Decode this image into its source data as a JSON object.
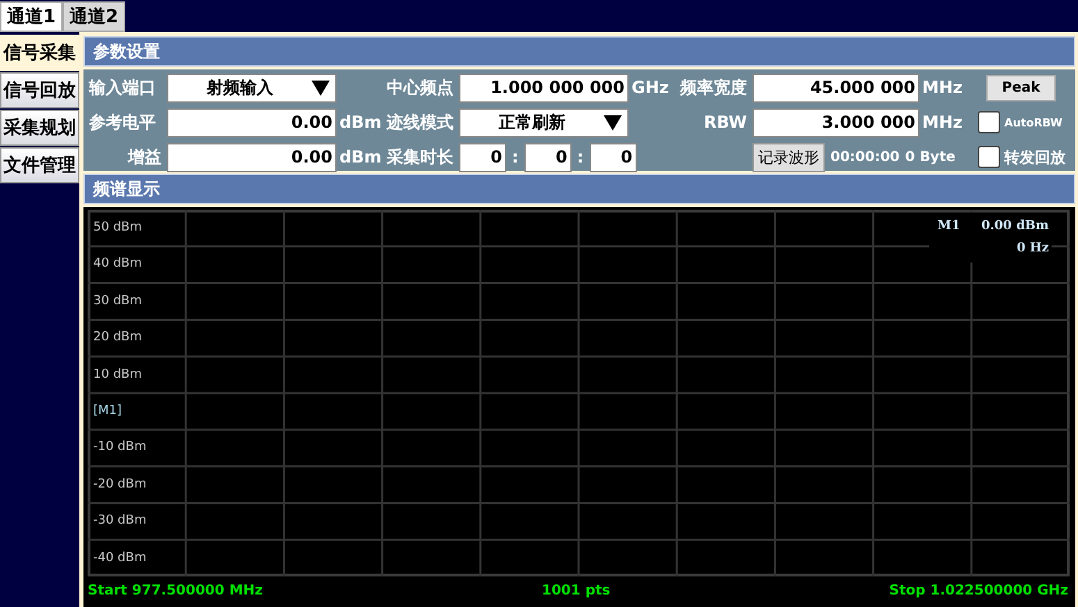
{
  "channel_tabs": [
    {
      "label": "通道1",
      "selected": true
    },
    {
      "label": "通道2",
      "selected": false
    }
  ],
  "side_tabs": [
    {
      "label": "信号采集",
      "selected": true
    },
    {
      "label": "信号回放",
      "selected": false
    },
    {
      "label": "采集规划",
      "selected": false
    },
    {
      "label": "文件管理",
      "selected": false
    }
  ],
  "params": {
    "title": "参数设置",
    "input_port": {
      "label": "输入端口",
      "value": "射频输入"
    },
    "ref_level": {
      "label": "参考电平",
      "value": "0.00",
      "unit": "dBm"
    },
    "gain": {
      "label": "增益",
      "value": "0.00",
      "unit": "dBm"
    },
    "center_freq": {
      "label": "中心频点",
      "value": "1.000 000 000",
      "unit": "GHz"
    },
    "trace_mode": {
      "label": "迹线模式",
      "value": "正常刷新"
    },
    "capture_duration": {
      "label": "采集时长",
      "values": [
        "0",
        "0",
        "0"
      ],
      "separators": [
        ":",
        ":"
      ]
    },
    "span": {
      "label": "频率宽度",
      "value": "45.000 000",
      "unit": "MHz"
    },
    "rbw": {
      "label": "RBW",
      "value": "3.000 000",
      "unit": "MHz"
    },
    "record_button": "记录波形",
    "record_time": "00:00:00",
    "record_size": "0 Byte",
    "peak_button": "Peak",
    "auto_rbw": {
      "label": "AutoRBW",
      "checked": false
    },
    "forward_playback": {
      "label": "转发回放",
      "checked": false
    }
  },
  "spectrum": {
    "title": "频谱显示",
    "y_labels": [
      {
        "text": "50 dBm",
        "kind": "axis"
      },
      {
        "text": "40 dBm",
        "kind": "axis"
      },
      {
        "text": "30 dBm",
        "kind": "axis"
      },
      {
        "text": "20 dBm",
        "kind": "axis"
      },
      {
        "text": "10 dBm",
        "kind": "axis"
      },
      {
        "text": "[M1]",
        "kind": "marker"
      },
      {
        "text": "-10 dBm",
        "kind": "axis"
      },
      {
        "text": "-20 dBm",
        "kind": "axis"
      },
      {
        "text": "-30 dBm",
        "kind": "axis"
      },
      {
        "text": "-40 dBm",
        "kind": "axis"
      }
    ],
    "marker_readout": {
      "name": "M1",
      "level": "0.00 dBm",
      "freq": "0 Hz"
    },
    "start": "Start 977.500000 MHz",
    "points": "1001 pts",
    "stop": "Stop 1.022500000 GHz"
  }
}
